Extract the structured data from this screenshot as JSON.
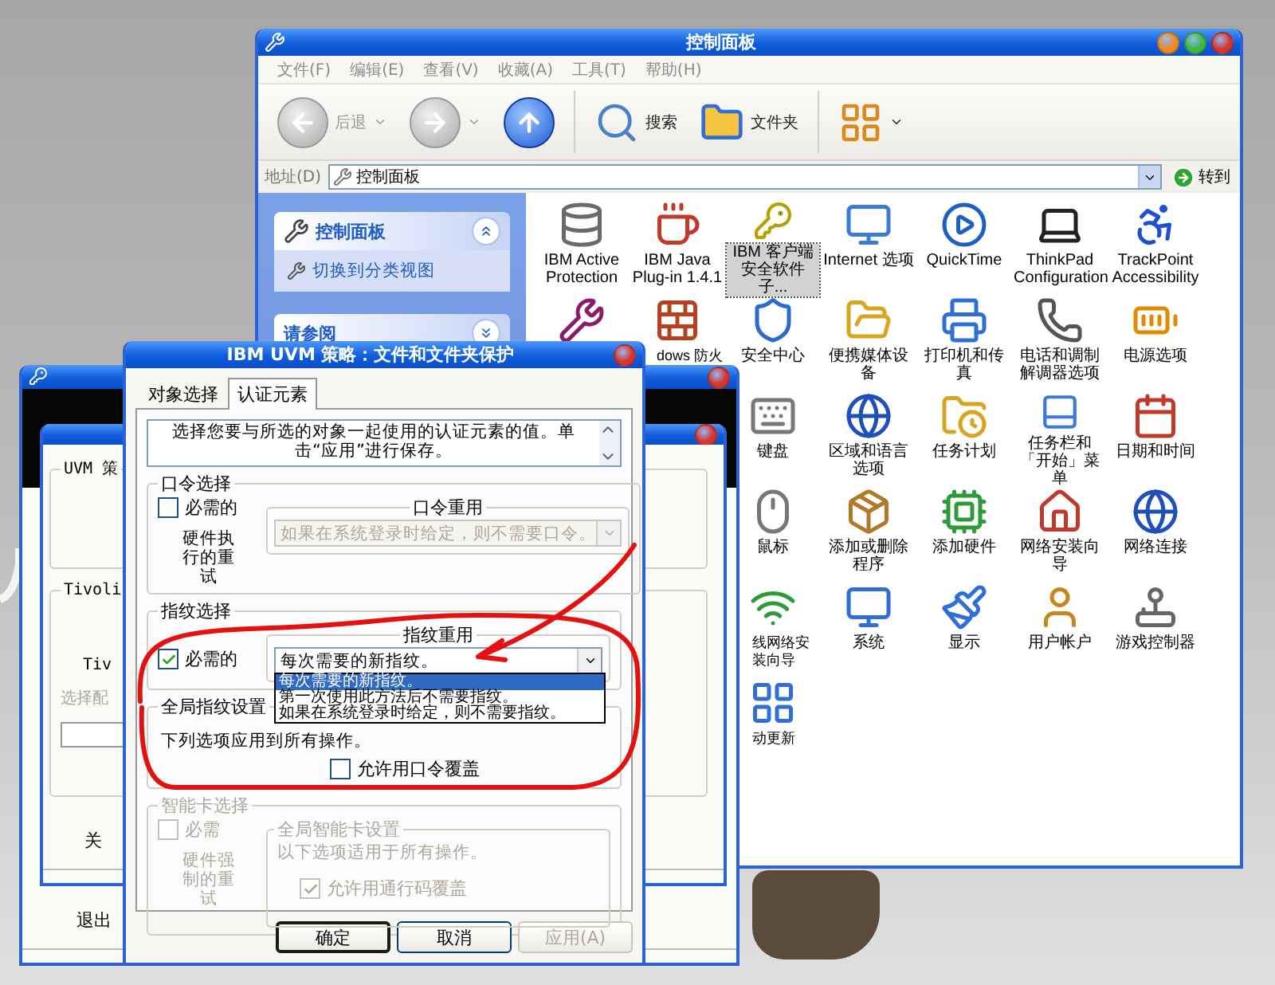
{
  "control_panel": {
    "title": "控制面板",
    "menu": [
      "文件(F)",
      "编辑(E)",
      "查看(V)",
      "收藏(A)",
      "工具(T)",
      "帮助(H)"
    ],
    "toolbar": [
      {
        "kind": "back",
        "label": "后退",
        "disabled": true
      },
      {
        "kind": "forward",
        "disabled": true
      },
      {
        "kind": "up",
        "disabled": false
      },
      {
        "kind": "search",
        "label": "搜索"
      },
      {
        "kind": "folders",
        "label": "文件夹"
      },
      {
        "kind": "views"
      }
    ],
    "address": {
      "label": "地址(D)",
      "value": "控制面板",
      "go": "转到"
    },
    "sidebar": {
      "panel_title": "控制面板",
      "link": "切换到分类视图",
      "see_also": "请参阅"
    },
    "icon_rows": [
      [
        {
          "label": "IBM Active Protection",
          "selected": false
        },
        {
          "label": "IBM Java Plug-in 1.4.1",
          "selected": false
        },
        {
          "label": "IBM 客户端安全软件子...",
          "selected": true
        },
        {
          "label": "Internet 选项",
          "selected": false
        },
        {
          "label": "QuickTime",
          "selected": false
        },
        {
          "label": "ThinkPad Configuration",
          "selected": false
        },
        {
          "label": "TrackPoint Accessibility",
          "selected": false
        }
      ],
      [
        {
          "selected": false
        },
        {
          "label": "dows 防火",
          "kind": "clipped",
          "selected": false
        },
        {
          "label": "安全中心",
          "selected": false
        },
        {
          "label": "便携媒体设备",
          "selected": false
        },
        {
          "label": "打印机和传真",
          "selected": false
        },
        {
          "label": "电话和调制解调器选项",
          "selected": false
        },
        {
          "label": "电源选项",
          "selected": false
        }
      ],
      [
        null,
        null,
        {
          "label": "键盘",
          "selected": false
        },
        {
          "label": "区域和语言选项",
          "selected": false
        },
        {
          "label": "任务计划",
          "selected": false
        },
        {
          "label": "任务栏和「开始」菜单",
          "selected": false
        },
        {
          "label": "日期和时间",
          "selected": false
        }
      ],
      [
        null,
        null,
        {
          "label": "鼠标",
          "selected": false
        },
        {
          "label": "添加或删除程序",
          "selected": false
        },
        {
          "label": "添加硬件",
          "selected": false
        },
        {
          "label": "网络安装向导",
          "selected": false
        },
        {
          "label": "网络连接",
          "selected": false
        }
      ],
      [
        null,
        null,
        {
          "label": "线网络安装向导",
          "kind": "clipped",
          "selected": false
        },
        {
          "label": "系统",
          "selected": false
        },
        {
          "label": "显示",
          "selected": false
        },
        {
          "label": "用户帐户",
          "selected": false
        },
        {
          "label": "游戏控制器",
          "selected": false
        }
      ],
      [
        null,
        null,
        {
          "label": "动更新",
          "kind": "clipped",
          "selected": false
        }
      ]
    ]
  },
  "tool_window": {
    "exit_button": "退出"
  },
  "policy_window": {
    "group_title": "UVM 策",
    "tivoli_title": "Tivoli",
    "tivoli_text": "Tiv",
    "select_label": "选择配",
    "close_button": "关"
  },
  "dialog": {
    "title": "IBM UVM 策略：文件和文件夹保护",
    "tabs": [
      {
        "label": "对象选择",
        "selected": false
      },
      {
        "label": "认证元素",
        "selected": true
      }
    ],
    "description": "选择您要与所选的对象一起使用的认证元素的值。单击“应用”进行保存。",
    "password_group": {
      "title": "口令选择",
      "required": {
        "label": "必需的",
        "checked": false
      },
      "retry_label": "硬件执行的重试",
      "reuse_title": "口令重用",
      "reuse_value": "如果在系统登录时给定，则不需要口令。",
      "disabled": true
    },
    "fingerprint_group": {
      "title": "指纹选择",
      "required": {
        "label": "必需的",
        "checked": true
      },
      "reuse_title": "指纹重用",
      "reuse_value": "每次需要的新指纹。",
      "expanded": true,
      "options": [
        {
          "label": "每次需要的新指纹。",
          "selected": true
        },
        {
          "label": "第一次使用此方法后不需要指纹。",
          "selected": false
        },
        {
          "label": "如果在系统登录时给定，则不需要指纹。",
          "selected": false
        }
      ]
    },
    "global_fingerprint": {
      "title": "全局指纹设置",
      "note": "下列选项应用到所有操作。",
      "override": {
        "label": "允许用口令覆盖",
        "checked": false
      }
    },
    "smartcard_group": {
      "title": "智能卡选择",
      "disabled": true,
      "required": {
        "label": "必需",
        "checked": false
      },
      "retry_label": "硬件强制的重试",
      "global_title": "全局智能卡设置",
      "note": "以下选项适用于所有操作。",
      "override": {
        "label": "允许用通行码覆盖",
        "checked": true
      }
    },
    "buttons": [
      {
        "label": "确定",
        "default": true,
        "disabled": false
      },
      {
        "label": "取消",
        "default": false,
        "disabled": false
      },
      {
        "label": "应用(A)",
        "default": false,
        "disabled": true
      }
    ]
  }
}
